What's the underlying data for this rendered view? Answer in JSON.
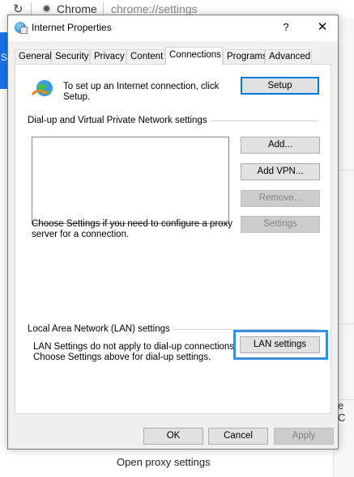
{
  "browser": {
    "reload_glyph": "↻",
    "chrome_label": "Chrome",
    "url": "chrome://settings",
    "bottom_text": "Open proxy settings",
    "right_truncated": "e C",
    "left_blue_glyph": "S"
  },
  "dialog": {
    "title": "Internet Properties",
    "help_glyph": "?",
    "close_glyph": "✕",
    "tabs": [
      {
        "label": "General",
        "active": false
      },
      {
        "label": "Security",
        "active": false
      },
      {
        "label": "Privacy",
        "active": false
      },
      {
        "label": "Content",
        "active": false
      },
      {
        "label": "Connections",
        "active": true
      },
      {
        "label": "Programs",
        "active": false
      },
      {
        "label": "Advanced",
        "active": false
      }
    ],
    "setup": {
      "text": "To set up an Internet connection, click Setup.",
      "button": "Setup"
    },
    "dialup_group": {
      "label": "Dial-up and Virtual Private Network settings",
      "add_button": "Add...",
      "add_vpn_button": "Add VPN...",
      "remove_button": "Remove...",
      "settings_button": "Settings",
      "proxy_text": "Choose Settings if you need to configure a proxy server for a connection."
    },
    "lan_group": {
      "label": "Local Area Network (LAN) settings",
      "text": "LAN Settings do not apply to dial-up connections. Choose Settings above for dial-up settings.",
      "button": "LAN settings"
    },
    "footer": {
      "ok": "OK",
      "cancel": "Cancel",
      "apply": "Apply"
    }
  },
  "colors": {
    "highlight": "#3a8fd9",
    "default_button_border": "#0078d7"
  },
  "icons": {
    "globe": "network-globe-icon",
    "title": "internet-properties-icon"
  }
}
